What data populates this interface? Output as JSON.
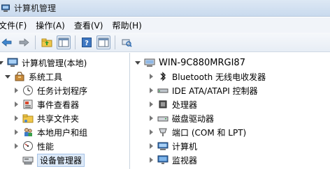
{
  "window": {
    "title": "计算机管理"
  },
  "menu": [
    "文件(F)",
    "操作(A)",
    "查看(V)",
    "帮助(H)"
  ],
  "toolbar": {
    "buttons": [
      "back-icon",
      "forward-icon",
      "up-folder-icon",
      "show-hide-tree-icon",
      "help-icon",
      "action-pane-icon",
      "scan-hardware-icon"
    ]
  },
  "left_tree": {
    "root": "计算机管理(本地)",
    "system_tools": "系统工具",
    "items": [
      "任务计划程序",
      "事件查看器",
      "共享文件夹",
      "本地用户和组",
      "性能",
      "设备管理器"
    ]
  },
  "right_tree": {
    "computer": "WIN-9C880MRGI87",
    "devices": [
      "Bluetooth 无线电收发器",
      "IDE ATA/ATAPI 控制器",
      "处理器",
      "磁盘驱动器",
      "端口 (COM 和 LPT)",
      "计算机",
      "监视器"
    ]
  }
}
